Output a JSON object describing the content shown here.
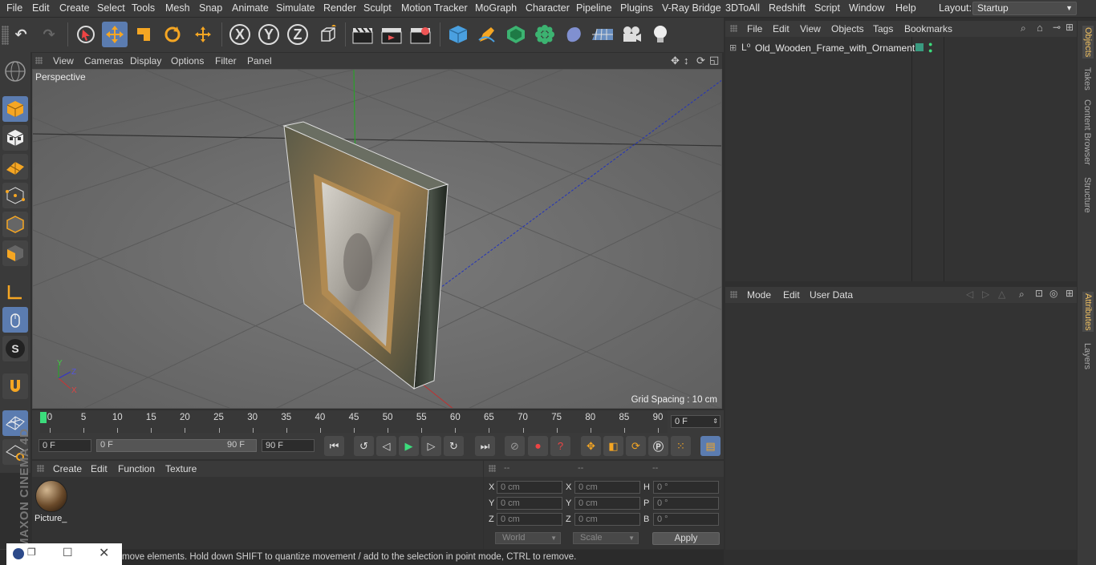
{
  "menu": [
    "File",
    "Edit",
    "Create",
    "Select",
    "Tools",
    "Mesh",
    "Snap",
    "Animate",
    "Simulate",
    "Render",
    "Sculpt",
    "Motion Tracker",
    "MoGraph",
    "Character",
    "Pipeline",
    "Plugins",
    "V-Ray Bridge",
    "3DToAll",
    "Redshift",
    "Script",
    "Window",
    "Help"
  ],
  "layout": {
    "label": "Layout:",
    "value": "Startup"
  },
  "toolbar": {
    "undo": "undo-icon",
    "redo": "redo-icon",
    "x_axis": "X",
    "y_axis": "Y",
    "z_axis": "Z"
  },
  "viewport": {
    "menu": [
      "View",
      "Cameras",
      "Display",
      "Options",
      "Filter",
      "Panel"
    ],
    "label": "Perspective",
    "grid": "Grid Spacing : 10 cm",
    "axis_x": "X",
    "axis_y": "Y",
    "axis_z": "Z"
  },
  "timeline": {
    "ticks": [
      "0",
      "5",
      "10",
      "15",
      "20",
      "25",
      "30",
      "35",
      "40",
      "45",
      "50",
      "55",
      "60",
      "65",
      "70",
      "75",
      "80",
      "85",
      "90"
    ],
    "current_frame": "0 F"
  },
  "transport": {
    "start_field": "0 F",
    "range_start": "0 F",
    "range_end": "90 F",
    "end_field": "90 F"
  },
  "materials": {
    "menu": [
      "Create",
      "Edit",
      "Function",
      "Texture"
    ],
    "item_name": "Picture_"
  },
  "coordinates": {
    "headers": [
      "--",
      "--",
      "--"
    ],
    "rows": [
      {
        "l1": "X",
        "v1": "0 cm",
        "l2": "X",
        "v2": "0 cm",
        "l3": "H",
        "v3": "0 °"
      },
      {
        "l1": "Y",
        "v1": "0 cm",
        "l2": "Y",
        "v2": "0 cm",
        "l3": "P",
        "v3": "0 °"
      },
      {
        "l1": "Z",
        "v1": "0 cm",
        "l2": "Z",
        "v2": "0 cm",
        "l3": "B",
        "v3": "0 °"
      }
    ],
    "mode": "World",
    "scale": "Scale",
    "apply": "Apply"
  },
  "status": "move elements. Hold down SHIFT to quantize movement / add to the selection in point mode, CTRL to remove.",
  "objects": {
    "menu": [
      "File",
      "Edit",
      "View",
      "Objects",
      "Tags",
      "Bookmarks"
    ],
    "item": "Old_Wooden_Frame_with_Ornament"
  },
  "attributes": {
    "menu": [
      "Mode",
      "Edit",
      "User Data"
    ]
  },
  "right_tabs": [
    "Objects",
    "Takes",
    "Content Browser",
    "Structure",
    "Attributes",
    "Layers"
  ],
  "branding": "MAXON CINEMA 4D"
}
